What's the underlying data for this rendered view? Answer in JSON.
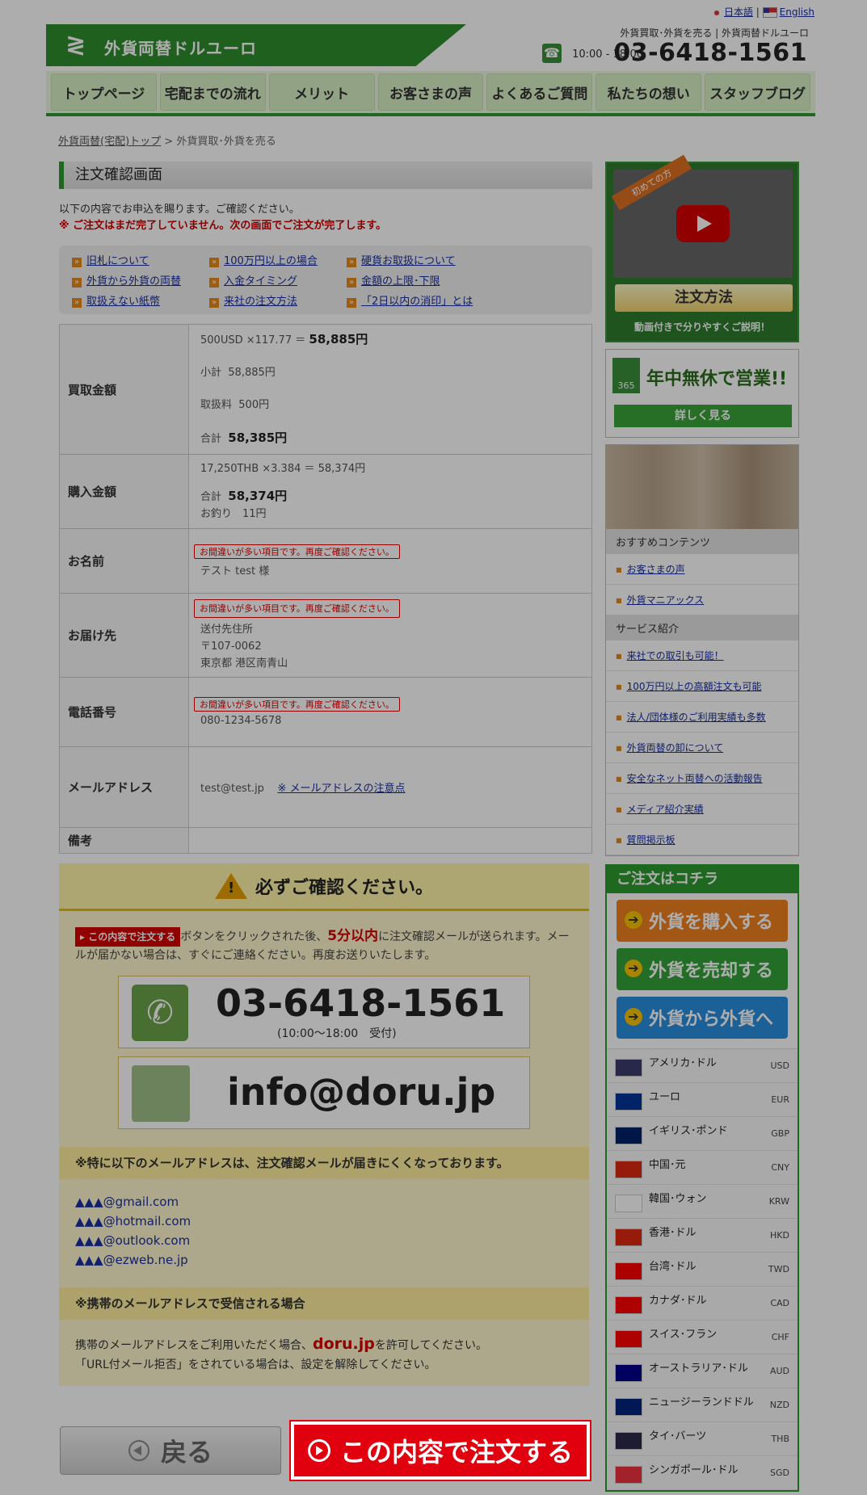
{
  "topbar": {
    "lang_ja": "日本語",
    "lang_en": "English"
  },
  "header": {
    "logo": "外貨両替ドルユーロ",
    "tagline": "外貨買取･外貨を売る | 外貨両替ドルユーロ",
    "hours": "10:00 - 18:00",
    "tel": "03-6418-1561"
  },
  "nav": [
    "トップページ",
    "宅配までの流れ",
    "メリット",
    "お客さまの声",
    "よくあるご質問",
    "私たちの想い",
    "スタッフブログ"
  ],
  "breadcrumb": {
    "home": "外貨両替(宅配)トップ",
    "sep": " > ",
    "current": "外貨買取･外貨を売る"
  },
  "page_title": "注文確認画面",
  "intro": {
    "line1": "以下の内容でお申込を賜ります。ご確認ください。",
    "warning": "※ ご注文はまだ完了していません。次の画面でご注文が完了します。"
  },
  "links": [
    "旧札について",
    "100万円以上の場合",
    "硬貨お取扱について",
    "外貨から外貨の両替",
    "入金タイミング",
    "金額の上限･下限",
    "取扱えない紙幣",
    "来社の注文方法",
    "「2日以内の消印」とは"
  ],
  "order": {
    "buy_label": "買取金額",
    "buy_calc": "500USD ×117.77 ＝",
    "buy_calc_total": "58,885円",
    "subtotal_label": "小計",
    "subtotal": "58,885円",
    "fee_label": "取扱料",
    "fee": "500円",
    "total_label": "合計",
    "total": "58,385円",
    "purchase_label": "購入金額",
    "purchase_calc": "17,250THB ×3.384 ＝ 58,374円",
    "purchase_total_label": "合計",
    "purchase_total": "58,374円",
    "change": "お釣り　11円",
    "name_label": "お名前",
    "error_note": "お間違いが多い項目です。再度ご確認ください。",
    "name": "テスト test 様",
    "address_label": "お届け先",
    "address1": "送付先住所",
    "address2": "〒107-0062",
    "address3": "東京都 港区南青山",
    "phone_label": "電話番号",
    "phone": "080-1234-5678",
    "email_label": "メールアドレス",
    "email": "test@test.jp",
    "email_note": "※ メールアドレスの注意点",
    "remarks_label": "備考"
  },
  "confirm": {
    "heading": "必ずご確認ください。",
    "btn_mini": "この内容で注文する",
    "text_a": "ボタンをクリックされた後、",
    "text_red": "5分以内",
    "text_b": "に注文確認メールが送られます。メールが届かない場合は、すぐにご連絡ください。再度お送りいたします。",
    "tel": "03-6418-1561",
    "tel_hours": "(10:00～18:00　受付)",
    "mail": "info@doru.jp",
    "sub1": "※特に以下のメールアドレスは、注文確認メールが届きにくくなっております。",
    "emails": [
      "▲▲▲@gmail.com",
      "▲▲▲@hotmail.com",
      "▲▲▲@outlook.com",
      "▲▲▲@ezweb.ne.jp"
    ],
    "sub2": "※携帯のメールアドレスで受信される場合",
    "mobile_a": "携帯のメールアドレスをご利用いただく場合、",
    "mobile_domain": "doru.jp",
    "mobile_b": "を許可してください。",
    "mobile_c": "「URL付メール拒否」をされている場合は、設定を解除してください。"
  },
  "buttons": {
    "back": "戻る",
    "order": "この内容で注文する"
  },
  "sidebar": {
    "video_ribbon": "初めての方",
    "video_title": "注文方法",
    "video_note": "動画付きで分りやすくご説明！",
    "open_a": "年中無休",
    "open_b": "で営業!!",
    "open_more": "詳しく見る",
    "recommend_head": "おすすめコンテンツ",
    "recommend": [
      "お客さまの声",
      "外貨マニアックス"
    ],
    "service_head": "サービス紹介",
    "services": [
      "来社での取引も可能！",
      "100万円以上の高額注文も可能",
      "法人/団体様のご利用実績も多数",
      "外貨両替の卸について",
      "安全なネット両替への活動報告",
      "メディア紹介実績",
      "質問掲示板"
    ],
    "order_head": "ご注文はコチラ",
    "order_buy": "外貨を購入する",
    "order_sell": "外貨を売却する",
    "order_fx": "外貨から外貨へ",
    "currencies": [
      {
        "name": "アメリカ･ドル",
        "code": "USD",
        "color": "#3c3b6e"
      },
      {
        "name": "ユーロ",
        "code": "EUR",
        "color": "#003399"
      },
      {
        "name": "イギリス･ポンド",
        "code": "GBP",
        "color": "#012169"
      },
      {
        "name": "中国･元",
        "code": "CNY",
        "color": "#de2910"
      },
      {
        "name": "韓国･ウォン",
        "code": "KRW",
        "color": "#ffffff"
      },
      {
        "name": "香港･ドル",
        "code": "HKD",
        "color": "#de2910"
      },
      {
        "name": "台湾･ドル",
        "code": "TWD",
        "color": "#fe0000"
      },
      {
        "name": "カナダ･ドル",
        "code": "CAD",
        "color": "#ff0000"
      },
      {
        "name": "スイス･フラン",
        "code": "CHF",
        "color": "#ff0000"
      },
      {
        "name": "オーストラリア･ドル",
        "code": "AUD",
        "color": "#00008b"
      },
      {
        "name": "ニュージーランドドル",
        "code": "NZD",
        "color": "#00247d"
      },
      {
        "name": "タイ･バーツ",
        "code": "THB",
        "color": "#2d2a4a"
      },
      {
        "name": "シンガポール･ドル",
        "code": "SGD",
        "color": "#ef3340"
      }
    ]
  }
}
